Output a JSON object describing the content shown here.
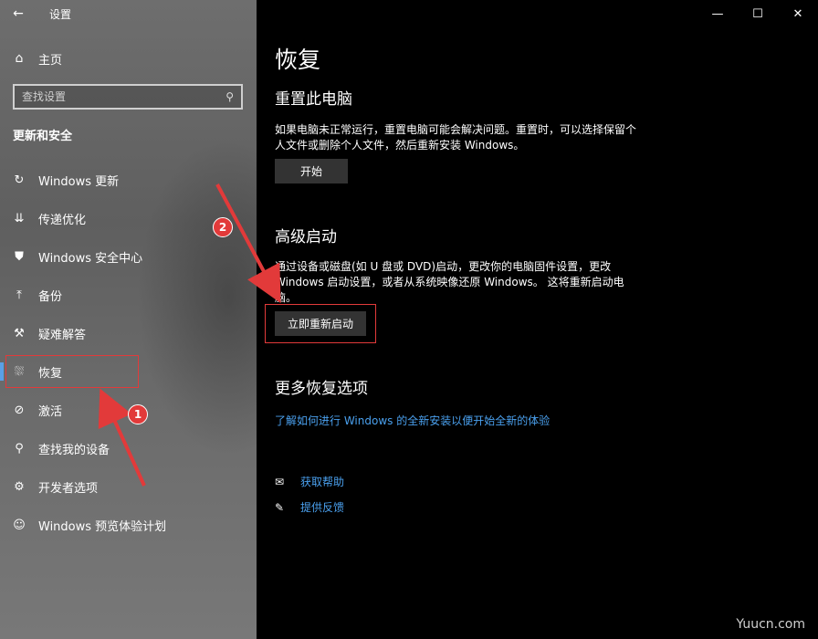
{
  "window": {
    "title": "设置",
    "back": "←",
    "minimize": "—",
    "maximize": "☐",
    "close": "✕"
  },
  "sidebar": {
    "home": {
      "icon": "⌂",
      "label": "主页"
    },
    "search_placeholder": "查找设置",
    "search_icon": "⚲",
    "section": "更新和安全",
    "items": [
      {
        "icon": "↻",
        "label": "Windows 更新"
      },
      {
        "icon": "⇊",
        "label": "传递优化"
      },
      {
        "icon": "⛊",
        "label": "Windows 安全中心"
      },
      {
        "icon": "⤒",
        "label": "备份"
      },
      {
        "icon": "⚒",
        "label": "疑难解答"
      },
      {
        "icon": "⛆",
        "label": "恢复"
      },
      {
        "icon": "⊘",
        "label": "激活"
      },
      {
        "icon": "⚲",
        "label": "查找我的设备"
      },
      {
        "icon": "⚙",
        "label": "开发者选项"
      },
      {
        "icon": "☺",
        "label": "Windows 预览体验计划"
      }
    ]
  },
  "main": {
    "title": "恢复",
    "reset": {
      "heading": "重置此电脑",
      "desc": "如果电脑未正常运行，重置电脑可能会解决问题。重置时，可以选择保留个人文件或删除个人文件，然后重新安装 Windows。",
      "button": "开始"
    },
    "advanced": {
      "heading": "高级启动",
      "desc": "通过设备或磁盘(如 U 盘或 DVD)启动，更改你的电脑固件设置，更改 Windows 启动设置，或者从系统映像还原 Windows。 这将重新启动电脑。",
      "button": "立即重新启动"
    },
    "more": {
      "heading": "更多恢复选项",
      "link": "了解如何进行 Windows 的全新安装以便开始全新的体验"
    },
    "help": [
      {
        "icon": "✉",
        "label": "获取帮助"
      },
      {
        "icon": "✎",
        "label": "提供反馈"
      }
    ]
  },
  "annotations": {
    "badge1": "1",
    "badge2": "2",
    "color": "#e23a3a"
  },
  "watermark": "Yuucn.com"
}
